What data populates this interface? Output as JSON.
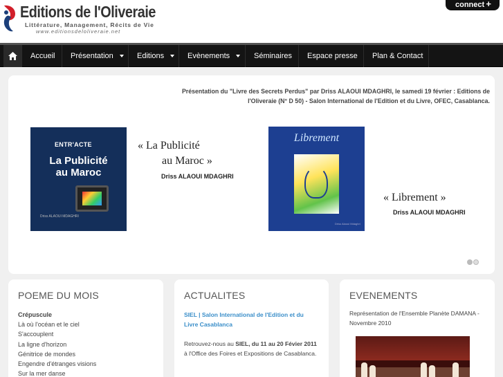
{
  "brand": {
    "title": "Editions de l'Oliveraie",
    "subtitle": "Littérature, Management, Récits de Vie",
    "url": "www.editionsdeloliveraie.net",
    "colors": {
      "logo_red": "#d21f2a",
      "logo_blue": "#1c3f7a"
    }
  },
  "connect": {
    "label": "connect",
    "plus": "+"
  },
  "nav": {
    "home_icon": "home-icon",
    "items": [
      {
        "label": "Accueil"
      },
      {
        "label": "Présentation"
      },
      {
        "label": "Editions"
      },
      {
        "label": "Evènements"
      },
      {
        "label": "Séminaires"
      },
      {
        "label": "Espace presse"
      },
      {
        "label": "Plan & Contact"
      }
    ]
  },
  "slider": {
    "caption": "Présentation du \"Livre des Secrets Perdus\" par Driss ALAOUI MDAGHRI, le samedi 19 février : Editions de l'Oliveraie (N° D 50) - Salon International de l'Edition et du Livre, OFEC, Casablanca.",
    "book1": {
      "brand": "ENTR'ACTE",
      "title_line1": "La Publicité",
      "title_line2": "au Maroc",
      "author_small": "Driss ALAOUI MDAGHRI"
    },
    "quote1_line1": "« La Publicité",
    "quote1_line2": "au Maroc »",
    "author1": "Driss ALAOUI MDAGHRI",
    "book2": {
      "title": "Librement",
      "signature": "Driss Alaoui Mdaghri"
    },
    "quote2": "« Librement »",
    "author2": "Driss ALAOUI MDAGHRI",
    "pages": 2,
    "active_page": 2
  },
  "poem": {
    "heading": "POEME DU MOIS",
    "lines": [
      "Crépuscule",
      "Là où l'océan et le ciel",
      "S'accouplent",
      "La ligne d'horizon",
      "Génitrice de mondes",
      "Engendre d'étranges visions",
      "Sur la mer danse"
    ]
  },
  "actualites": {
    "heading": "ACTUALITES",
    "link": "SIEL | Salon International de l'Edition et du Livre Casablanca",
    "text_pre": "Retrouvez-nous au ",
    "text_bold": "SIEL, du 11 au 20 Févier 2011",
    "text_post": " à l'Office des Foires et Expositions de Casablanca."
  },
  "evenements": {
    "heading": "EVENEMENTS",
    "text": "Représentation de l'Ensemble Planète DAMANA - Novembre 2010"
  }
}
